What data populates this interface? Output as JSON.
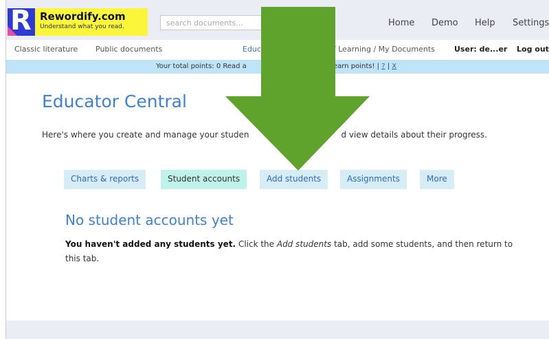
{
  "header": {
    "logo_letter": "R",
    "logo_title": "Rewordify.com",
    "logo_tagline": "Understand what you read.",
    "search_placeholder": "search documents...",
    "nav": [
      "Home",
      "Demo",
      "Help",
      "Settings"
    ]
  },
  "subnav": {
    "classic": "Classic literature",
    "public": "Public documents",
    "educator": "Educ",
    "learning": "/ Learning / My Documents",
    "user": "User: de...er",
    "logout": "Log out"
  },
  "points_bar": {
    "text_before": "Your total points: 0  Read a",
    "text_after": "earn points!  |",
    "help_link": "?",
    "separator": "|",
    "close_link": "X"
  },
  "main": {
    "title": "Educator Central",
    "intro_start": "Here's where you create and manage your studen",
    "intro_end": "d view details about their progress.",
    "tabs": [
      {
        "label": "Charts & reports",
        "active": false
      },
      {
        "label": "Student accounts",
        "active": true
      },
      {
        "label": "Add students",
        "active": false
      },
      {
        "label": "Assignments",
        "active": false
      },
      {
        "label": "More",
        "active": false
      }
    ],
    "section_title": "No student accounts yet",
    "message_bold": "You haven't added any students yet.",
    "message_part1": " Click the ",
    "message_italic": "Add students",
    "message_part2": " tab, add some students, and then return to this tab."
  },
  "overlay": {
    "arrow_color": "#5fa22c",
    "arrow_icon": "down-arrow-icon"
  }
}
